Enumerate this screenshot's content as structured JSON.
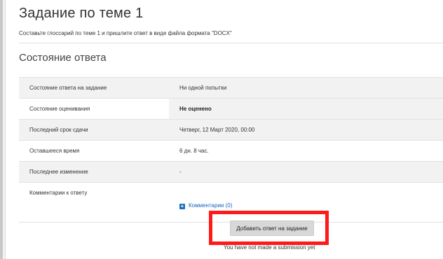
{
  "assignment": {
    "title": "Задание по теме 1",
    "description": "Составьте глоссарий по теме 1 и пришлите ответ в виде файла формата \"DOCX\""
  },
  "submission_status": {
    "heading": "Состояние ответа",
    "rows": [
      {
        "label": "Состояние ответа на задание",
        "value": "Ни одной попытки"
      },
      {
        "label": "Состояние оценивания",
        "value": "Не оценено"
      },
      {
        "label": "Последний срок сдачи",
        "value": "Четверг, 12 Март 2020, 00:00"
      },
      {
        "label": "Оставшееся время",
        "value": "6 дн. 8 час."
      },
      {
        "label": "Последнее изменение",
        "value": "-"
      },
      {
        "label": "Комментарии к ответу",
        "value": ""
      }
    ],
    "comments_link": "Комментарии (0)",
    "comments_icon": "plus-square-icon"
  },
  "actions": {
    "add_submission_label": "Добавить ответ на задание",
    "no_submission_text": "You have not made a submission yet"
  },
  "colors": {
    "highlight": "#ff1a1a",
    "link": "#1565c0",
    "row_shade": "#f2f2f2"
  }
}
